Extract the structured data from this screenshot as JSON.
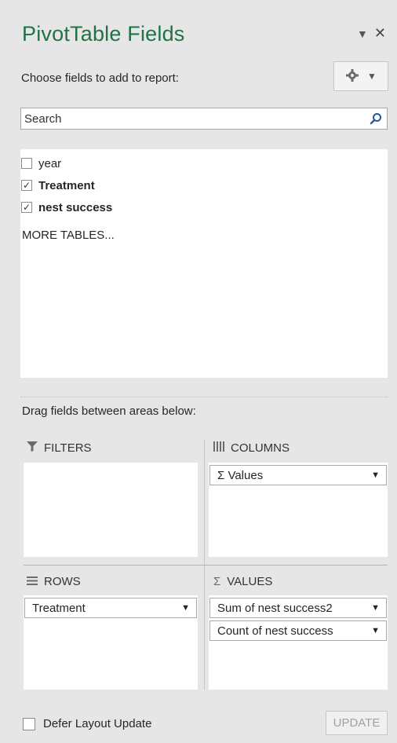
{
  "pane": {
    "title": "PivotTable Fields",
    "choose_label": "Choose fields to add to report:",
    "search": {
      "placeholder": "Search"
    },
    "fields": [
      {
        "label": "year",
        "checked": false
      },
      {
        "label": "Treatment",
        "checked": true
      },
      {
        "label": "nest success",
        "checked": true
      }
    ],
    "more_tables": "MORE TABLES...",
    "drag_label": "Drag fields between areas below:"
  },
  "areas": {
    "filters": {
      "label": "FILTERS",
      "items": []
    },
    "columns": {
      "label": "COLUMNS",
      "items": [
        "Σ Values"
      ]
    },
    "rows": {
      "label": "ROWS",
      "items": [
        "Treatment"
      ]
    },
    "values": {
      "label": "VALUES",
      "items": [
        "Sum of nest success2",
        "Count of nest success"
      ]
    }
  },
  "footer": {
    "defer_label": "Defer Layout Update",
    "update_label": "UPDATE"
  },
  "colors": {
    "title": "#217346",
    "background": "#e6e6e6"
  }
}
